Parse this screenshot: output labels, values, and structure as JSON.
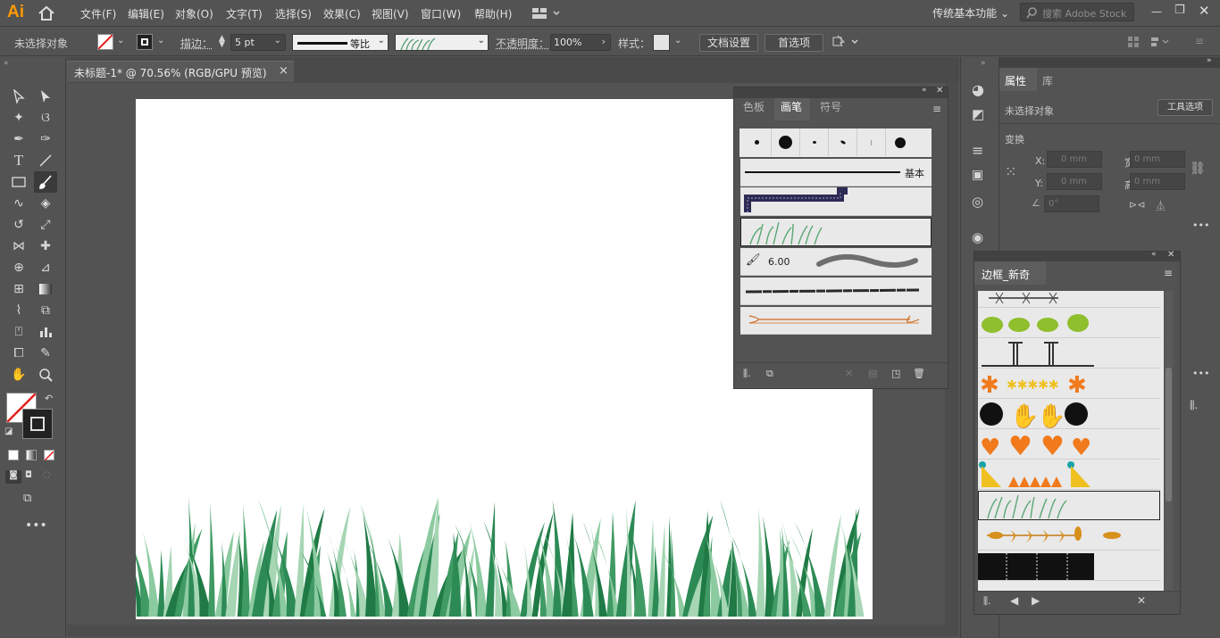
{
  "app": {
    "logo": "Ai",
    "workspace": "传统基本功能",
    "search_placeholder": "搜索 Adobe Stock"
  },
  "menu": [
    "文件(F)",
    "编辑(E)",
    "对象(O)",
    "文字(T)",
    "选择(S)",
    "效果(C)",
    "视图(V)",
    "窗口(W)",
    "帮助(H)"
  ],
  "control": {
    "selection": "未选择对象",
    "stroke_label": "描边：",
    "stroke_value": "5 pt",
    "profile": "等比",
    "opacity_label": "不透明度：",
    "opacity_value": "100%",
    "style_label": "样式：",
    "doc_setup": "文档设置",
    "prefs": "首选项"
  },
  "document": {
    "tab_title": "未标题-1* @ 70.56% (RGB/GPU 预览)",
    "close": "×"
  },
  "brush_panel": {
    "tabs": [
      "色板",
      "画笔",
      "符号"
    ],
    "active_tab": "画笔",
    "basic_label": "基本",
    "brush_size": "6.00"
  },
  "properties": {
    "tabs": [
      "属性",
      "库"
    ],
    "selection": "未选择对象",
    "quick_action": "工具选项",
    "transform": "变换",
    "x_label": "X:",
    "y_label": "Y:",
    "w_label": "宽：",
    "h_label": "高：",
    "x_value": "0 mm",
    "y_value": "0 mm",
    "w_value": "0 mm",
    "h_value": "0 mm",
    "angle": "0°"
  },
  "library_panel": {
    "title": "边框_新奇"
  },
  "colors": {
    "accent": "#ff9a00",
    "grass_dark": "#1f7a45",
    "grass_light": "#8ccaa0"
  }
}
